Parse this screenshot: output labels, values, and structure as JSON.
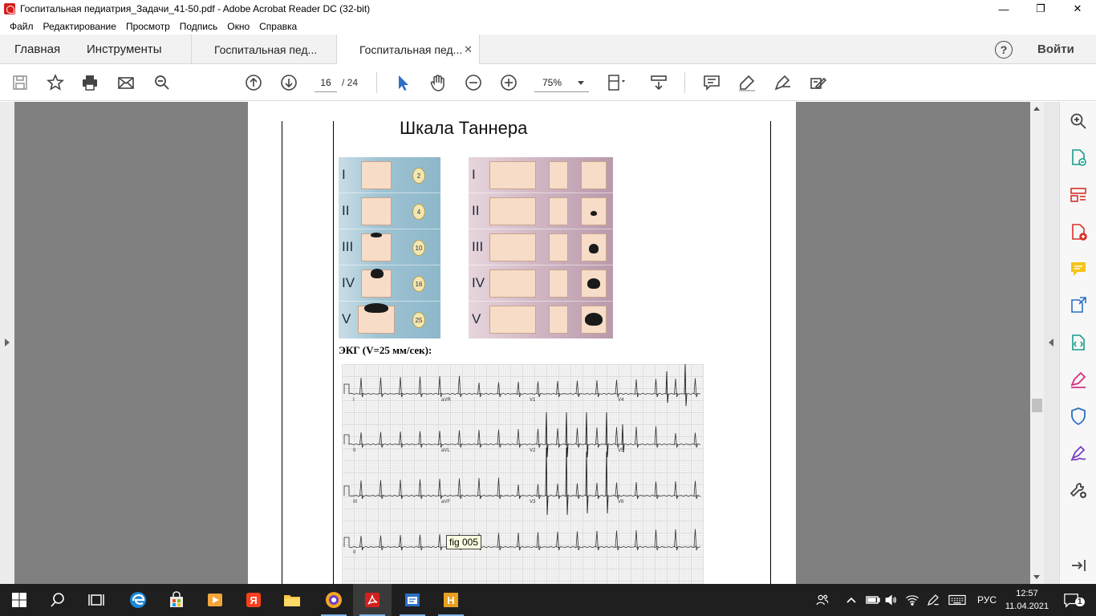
{
  "window": {
    "title": "Госпитальная педиатрия_Задачи_41-50.pdf - Adobe Acrobat Reader DC (32-bit)",
    "minimize": "—",
    "maximize": "❐",
    "close": "✕"
  },
  "menu": [
    "Файл",
    "Редактирование",
    "Просмотр",
    "Подпись",
    "Окно",
    "Справка"
  ],
  "tabs": {
    "home": "Главная",
    "tools": "Инструменты",
    "doc1": "Госпитальная пед...",
    "doc2": "Госпитальная пед...",
    "close": "✕",
    "help": "?",
    "signin": "Войти"
  },
  "toolbar": {
    "page_current": "16",
    "page_total": "/ 24",
    "zoom": "75%"
  },
  "document": {
    "heading": "Шкала Таннера",
    "roman": [
      "I",
      "II",
      "III",
      "IV",
      "V"
    ],
    "testis_volumes": [
      "2",
      "4",
      "10",
      "16",
      "25"
    ],
    "ecg_label": "ЭКГ (V=25 мм/сек):",
    "leads": [
      "I",
      "aVR",
      "V1",
      "V4",
      "II",
      "aVL",
      "V2",
      "V5",
      "III",
      "aVF",
      "V3",
      "V6",
      "II"
    ]
  },
  "tooltip": "fig 005",
  "taskbar": {
    "lang": "РУС",
    "time": "12:57",
    "date": "11.04.2021",
    "notifications": "1"
  },
  "colors": {
    "acrobat_red": "#d4201d",
    "doc_background": "#808080",
    "taskbar": "#1f1f1f"
  },
  "icons": {
    "toolbar": [
      "save-icon",
      "bookmark-star-icon",
      "print-icon",
      "email-icon",
      "zoom-search-icon",
      "page-up-icon",
      "page-down-icon",
      "select-cursor-icon",
      "hand-icon",
      "zoom-out-icon",
      "zoom-in-icon",
      "page-fit-icon",
      "scroll-mode-icon",
      "comment-icon",
      "highlight-icon",
      "fill-sign-icon",
      "more-tools-icon"
    ],
    "right_pane": [
      "zoom-icon",
      "create-pdf-icon",
      "organize-pages-icon",
      "add-pdf-icon",
      "comment-icon",
      "export-pdf-icon",
      "edit-pdf-icon",
      "fill-sign-icon",
      "protect-icon",
      "sign-icon",
      "more-tools-icon",
      "collapse-pane-icon"
    ]
  }
}
